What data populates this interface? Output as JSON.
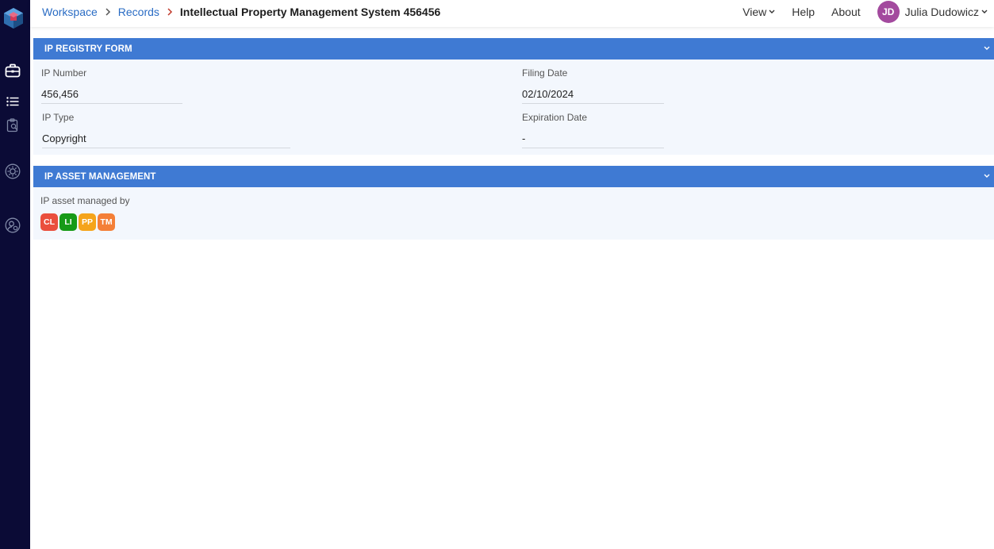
{
  "breadcrumb": {
    "items": [
      "Workspace",
      "Records"
    ],
    "current": "Intellectual Property Management System 456456"
  },
  "topnav": {
    "view": "View",
    "help": "Help",
    "about": "About",
    "user_initials": "JD",
    "user_name": "Julia Dudowicz"
  },
  "sidebar": {
    "icons": [
      "app-logo-icon",
      "briefcase-icon",
      "list-icon",
      "clipboard-search-icon",
      "gear-icon",
      "user-gear-icon"
    ]
  },
  "ip_registry": {
    "title": "IP REGISTRY FORM",
    "ip_number_label": "IP Number",
    "ip_number_value": "456,456",
    "filing_date_label": "Filing Date",
    "filing_date_value": "02/10/2024",
    "ip_type_label": "IP Type",
    "ip_type_value": "Copyright",
    "expiration_date_label": "Expiration Date",
    "expiration_date_value": "-"
  },
  "asset_management": {
    "title": "IP ASSET MANAGEMENT",
    "managed_by_label": "IP asset managed by",
    "badges": [
      {
        "text": "CL",
        "color": "#ea4f3d"
      },
      {
        "text": "LI",
        "color": "#179a17"
      },
      {
        "text": "PP",
        "color": "#f5a41a"
      },
      {
        "text": "TM",
        "color": "#f47f37"
      }
    ]
  },
  "colors": {
    "sidebar": "#0b0b36",
    "header_bar": "#3f7ad3",
    "link": "#2a6cc4",
    "avatar": "#a34a9e"
  }
}
